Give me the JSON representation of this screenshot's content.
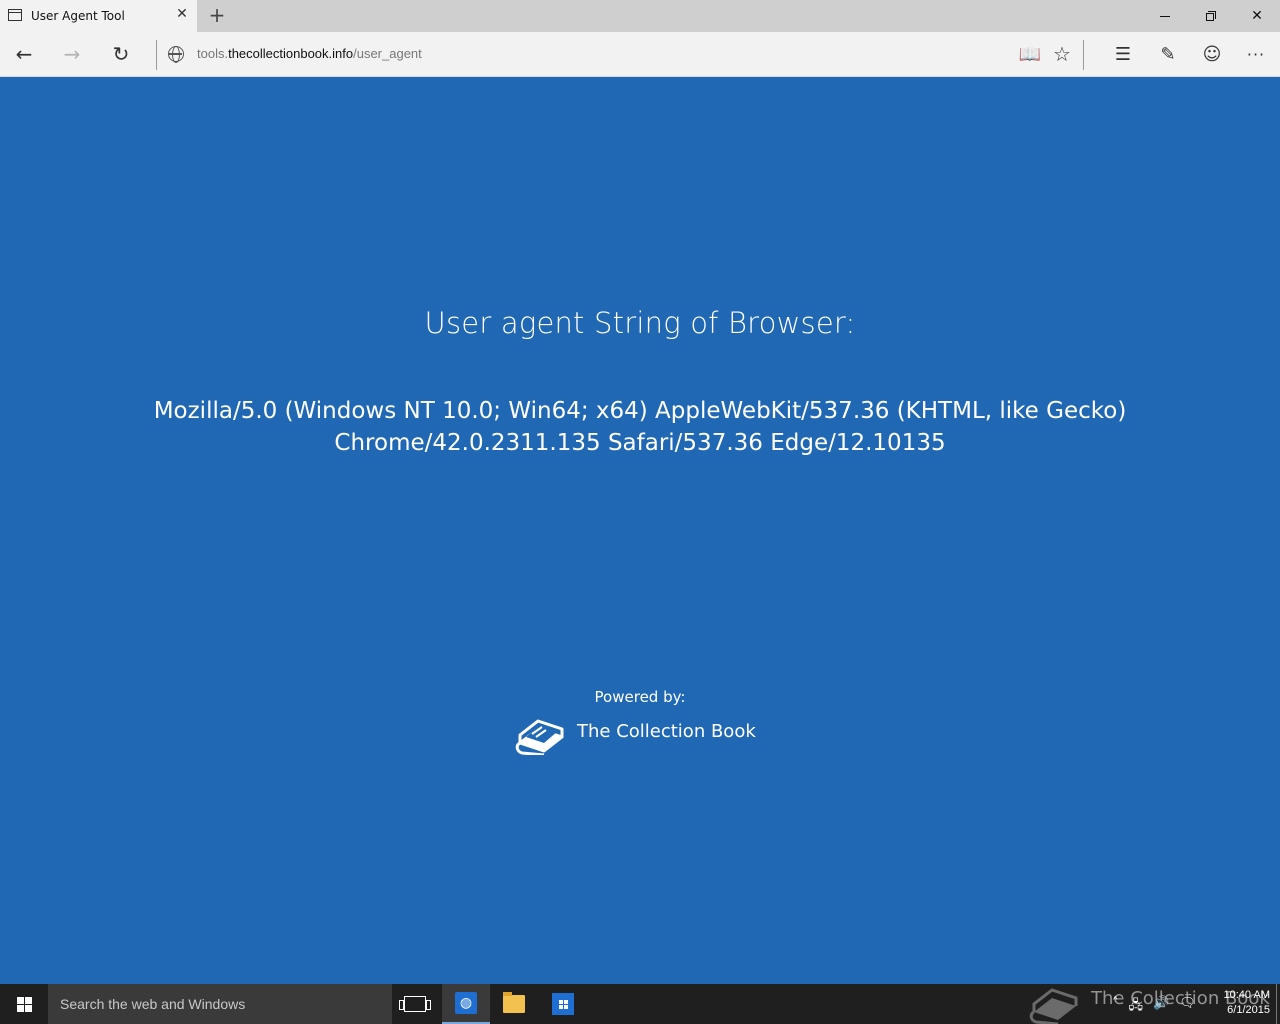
{
  "browser": {
    "tab_title": "User Agent Tool",
    "tab_close": "✕",
    "new_tab": "+",
    "address": {
      "prefix": "tools.",
      "host": "thecollectionbook.info",
      "path": "/user_agent"
    },
    "nav": {
      "back": "←",
      "forward": "→",
      "refresh": "↻"
    },
    "toolbar": {
      "reading_view": "📖",
      "favorite": "☆",
      "hub": "☰",
      "web_note": "✎",
      "feedback": "☺",
      "more": "···"
    },
    "window": {
      "close": "✕"
    }
  },
  "page": {
    "heading": "User agent String of Browser:",
    "ua_string": "Mozilla/5.0 (Windows NT 10.0; Win64; x64) AppleWebKit/537.36 (KHTML, like Gecko) Chrome/42.0.2311.135 Safari/537.36 Edge/12.10135",
    "powered_by": "Powered by:",
    "brand_name": "The Collection Book"
  },
  "taskbar": {
    "search_placeholder": "Search the web and Windows",
    "watermark_text": "The Collection Book",
    "clock_time": "10:40 AM",
    "clock_date": "6/1/2015",
    "tray": {
      "chevron": "˄",
      "network": "🖧",
      "volume": "🔊",
      "notifications": "🗨"
    }
  },
  "colors": {
    "page_background": "#2068b4",
    "taskbar": "#1f1f1f",
    "tab_bar": "#cfcfcf"
  }
}
